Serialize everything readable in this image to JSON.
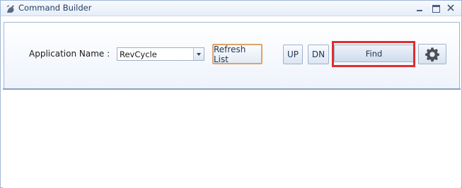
{
  "window": {
    "title": "Command Builder"
  },
  "icons": {
    "app": "command-builder-icon",
    "minimize": "minimize-icon",
    "maximize": "maximize-icon",
    "close": "close-icon",
    "settings": "gear-icon",
    "dropdown": "chevron-down-icon"
  },
  "toolbar": {
    "application_label": "Application Name :",
    "application_value": "RevCycle",
    "refresh_label": "Refresh List",
    "up_label": "UP",
    "dn_label": "DN",
    "find_label": "Find"
  },
  "colors": {
    "highlight": "#e02d2d",
    "refresh_focus_border": "#e0a36a",
    "window_border": "#9fb7d6"
  }
}
